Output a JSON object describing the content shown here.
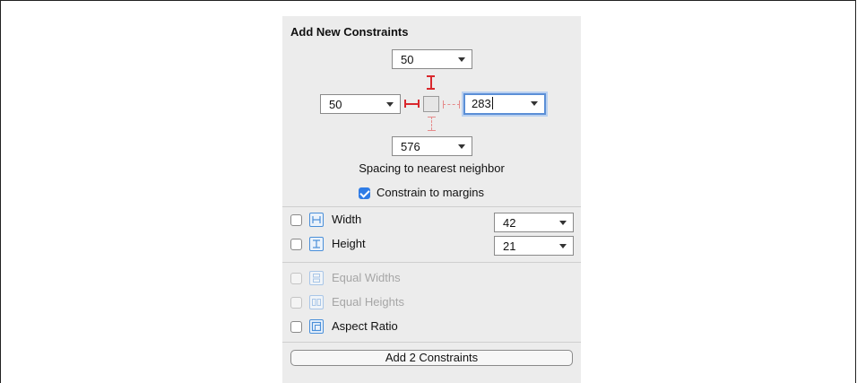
{
  "panel": {
    "title": "Add New Constraints",
    "spacing": {
      "top": "50",
      "left": "50",
      "right": "283",
      "bottom": "576",
      "caption": "Spacing to nearest neighbor"
    },
    "constrain_to_margins": {
      "label": "Constrain to margins",
      "checked": true
    },
    "size_rows": [
      {
        "label": "Width",
        "value": "42",
        "checked": false,
        "icon": "width-icon"
      },
      {
        "label": "Height",
        "value": "21",
        "checked": false,
        "icon": "height-icon"
      }
    ],
    "relation_rows": [
      {
        "label": "Equal Widths",
        "enabled": false,
        "icon": "equal-widths-icon"
      },
      {
        "label": "Equal Heights",
        "enabled": false,
        "icon": "equal-heights-icon"
      },
      {
        "label": "Aspect Ratio",
        "enabled": true,
        "icon": "aspect-ratio-icon"
      }
    ],
    "add_button": "Add 2 Constraints"
  },
  "colors": {
    "constraint_active": "#d9282d",
    "constraint_inactive": "#e58b8b",
    "focus_ring": "#5b8fd6",
    "checkbox_checked": "#2f7ce6",
    "icon_blue": "#4a8fd9"
  }
}
